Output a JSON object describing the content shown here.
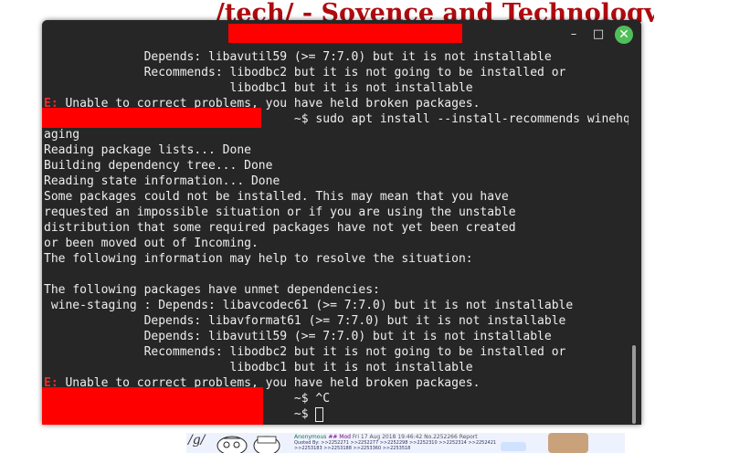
{
  "board": {
    "title": "/tech/ - Soyence and Technology",
    "logo": "/g/",
    "post_name": "Anonymous",
    "post_role": "## Mod",
    "post_date": "Fri 17 Aug 2018 19:46:42 No.2252266",
    "post_report": "Report",
    "post_quoted_by": "Quoted By: >>2252271 >>2252277 >>2252298 >>2252310 >>2252314 >>2252421",
    "post_quoted_by_2": ">>2253183 >>2253188 >>2253360 >>2253518"
  },
  "terminal": {
    "window_controls": {
      "minimize": "–",
      "maximize": "□",
      "close": "✕"
    },
    "lines": [
      {
        "text": "              Depends: libavutil59 (>= 7:7.0) but it is not installable"
      },
      {
        "text": "              Recommends: libodbc2 but it is not going to be installed or"
      },
      {
        "text": "                          libodbc1 but it is not installable"
      },
      {
        "prefix": "E:",
        "text": " Unable to correct problems, you have held broken packages."
      },
      {
        "text": "                                   ~$ sudo apt install --install-recommends winehq-st"
      },
      {
        "text": "aging"
      },
      {
        "text": "Reading package lists... Done"
      },
      {
        "text": "Building dependency tree... Done"
      },
      {
        "text": "Reading state information... Done"
      },
      {
        "text": "Some packages could not be installed. This may mean that you have"
      },
      {
        "text": "requested an impossible situation or if you are using the unstable"
      },
      {
        "text": "distribution that some required packages have not yet been created"
      },
      {
        "text": "or been moved out of Incoming."
      },
      {
        "text": "The following information may help to resolve the situation:"
      },
      {
        "text": ""
      },
      {
        "text": "The following packages have unmet dependencies:"
      },
      {
        "text": " wine-staging : Depends: libavcodec61 (>= 7:7.0) but it is not installable"
      },
      {
        "text": "              Depends: libavformat61 (>= 7:7.0) but it is not installable"
      },
      {
        "text": "              Depends: libavutil59 (>= 7:7.0) but it is not installable"
      },
      {
        "text": "              Recommends: libodbc2 but it is not going to be installed or"
      },
      {
        "text": "                          libodbc1 but it is not installable"
      },
      {
        "prefix": "E:",
        "text": " Unable to correct problems, you have held broken packages."
      },
      {
        "text": "                                   ~$ ^C"
      },
      {
        "text": "                                   ~$ ",
        "cursor": true
      }
    ]
  }
}
